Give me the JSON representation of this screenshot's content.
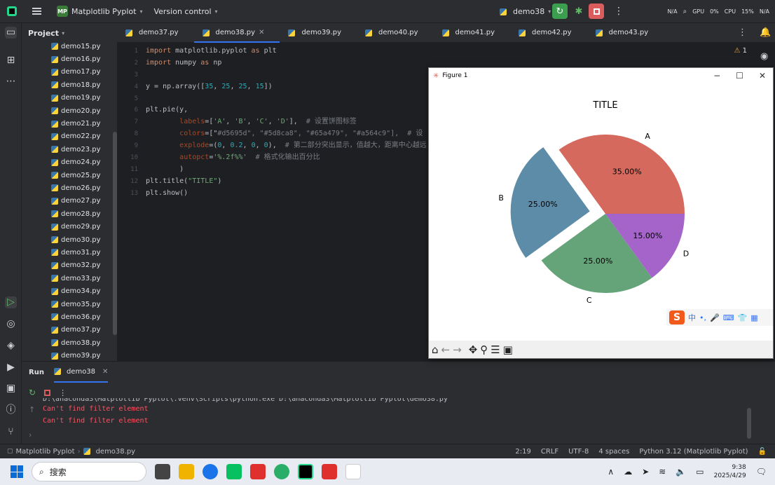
{
  "titlebar": {
    "project_name": "Matplotlib Pyplot",
    "project_badge": "MP",
    "vcs": "Version control",
    "run_config": "demo38",
    "gpu": "GPU",
    "gpu_val": "0%",
    "na1": "N/A",
    "cpu": "CPU",
    "cpu_val": "15%",
    "na2": "N/A"
  },
  "project_panel": {
    "title": "Project",
    "files": [
      "demo15.py",
      "demo16.py",
      "demo17.py",
      "demo18.py",
      "demo19.py",
      "demo20.py",
      "demo21.py",
      "demo22.py",
      "demo23.py",
      "demo24.py",
      "demo25.py",
      "demo26.py",
      "demo27.py",
      "demo28.py",
      "demo29.py",
      "demo30.py",
      "demo31.py",
      "demo32.py",
      "demo33.py",
      "demo34.py",
      "demo35.py",
      "demo36.py",
      "demo37.py",
      "demo38.py",
      "demo39.py"
    ]
  },
  "tabs": [
    "demo37.py",
    "demo38.py",
    "demo39.py",
    "demo40.py",
    "demo41.py",
    "demo42.py",
    "demo43.py"
  ],
  "editor": {
    "warnings": "1",
    "code_lines": [
      "import matplotlib.pyplot as plt",
      "import numpy as np",
      "",
      "y = np.array([35, 25, 25, 15])",
      "",
      "plt.pie(y,",
      "        labels=['A', 'B', 'C', 'D'],  # 设置饼图标签",
      "        colors=[\"#d5695d\", \"#5d8ca8\", \"#65a479\", \"#a564c9\"],  # 设",
      "        explode=(0, 0.2, 0, 0),  # 第二部分突出显示，值越大，距离中心越远",
      "        autopct='%.2f%%'  # 格式化输出百分比",
      "        )",
      "plt.title(\"TITLE\")",
      "plt.show()"
    ]
  },
  "run_panel": {
    "label": "Run",
    "tab": "demo38",
    "command": "D:\\anaconda3\\Matplotlib Pyplot\\.venv\\Scripts\\python.exe  D:\\anaconda3\\Matplotlib Pyplot\\demo38.py",
    "errors": [
      "Can't find filter element",
      "Can't find filter element"
    ]
  },
  "statusbar": {
    "project": "Matplotlib Pyplot",
    "file": "demo38.py",
    "position": "2:19",
    "line_sep": "CRLF",
    "encoding": "UTF-8",
    "indent": "4 spaces",
    "interpreter": "Python 3.12 (Matplotlib Pyplot)"
  },
  "figure": {
    "window_title": "Figure 1",
    "ime_lang": "中"
  },
  "chart_data": {
    "type": "pie",
    "title": "TITLE",
    "categories": [
      "A",
      "B",
      "C",
      "D"
    ],
    "values": [
      35,
      25,
      25,
      15
    ],
    "data_labels": [
      "35.00%",
      "25.00%",
      "25.00%",
      "15.00%"
    ],
    "colors": [
      "#d5695d",
      "#5d8ca8",
      "#65a479",
      "#a564c9"
    ],
    "explode": [
      0,
      0.2,
      0,
      0
    ]
  },
  "taskbar": {
    "search_placeholder": "搜索",
    "time": "9:38",
    "date": "2025/4/29"
  }
}
